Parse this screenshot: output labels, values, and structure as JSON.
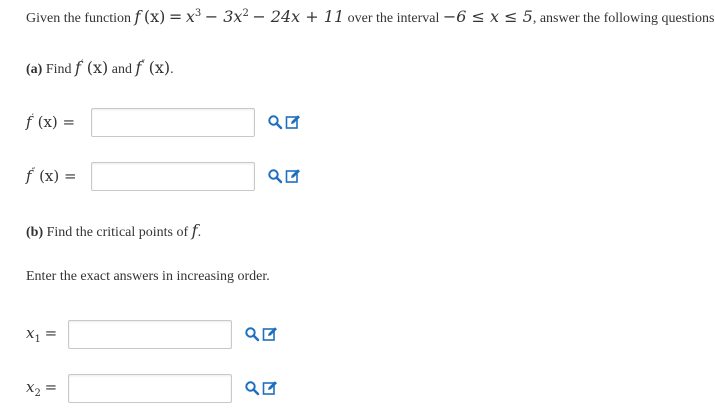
{
  "prompt": {
    "intro": "Given the function",
    "func_name": "f",
    "arg": "(x)",
    "equals": "=",
    "base": "x",
    "exp1": "3",
    "term2": "− 3x",
    "exp2": "2",
    "term3": "− 24x + 11",
    "over": "over the interval",
    "interval": "−6 ≤ x ≤ 5",
    "tail": ", answer the following questions."
  },
  "part_a": {
    "label": "(a)",
    "text_find": "Find",
    "f": "f",
    "prime": "′",
    "dprime": "″",
    "arg": "(x)",
    "and": "and",
    "end": "."
  },
  "fields": {
    "fprime_label_f": "f",
    "fprime_label_mark": "′",
    "fprime_label_rest": "(x) =",
    "fprime_value": "",
    "fdprime_label_f": "f",
    "fdprime_label_mark": "″",
    "fdprime_label_rest": "(x) =",
    "fdprime_value": "",
    "x1_label": "x",
    "x1_sub": "1",
    "x1_eq": "=",
    "x1_value": "",
    "x2_label": "x",
    "x2_sub": "2",
    "x2_eq": "=",
    "x2_value": ""
  },
  "part_b": {
    "label": "(b)",
    "text": "Find the critical points of",
    "f": "f",
    "end": "."
  },
  "instruction": "Enter the exact answers in increasing order.",
  "icons": {
    "preview": "magnifier-icon",
    "edit": "pencil-edit-icon",
    "color": "#1f6fbf"
  }
}
